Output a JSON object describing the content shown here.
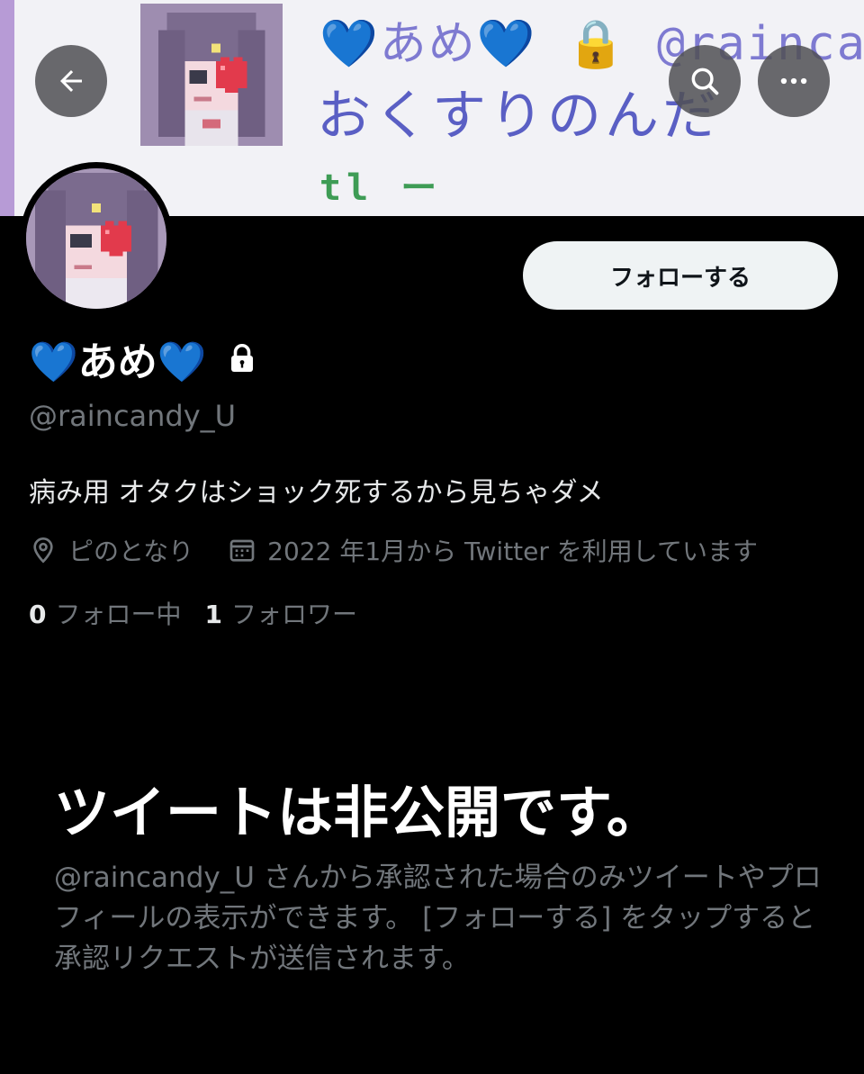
{
  "banner": {
    "line1": "💙あめ💙 🔒 @raincan",
    "line2": "おくすりのんだ",
    "line3": "tl ー"
  },
  "header": {
    "back_icon": "arrow-left-icon",
    "search_icon": "search-icon",
    "more_icon": "more-horizontal-icon"
  },
  "profile": {
    "display_name": "💙あめ💙",
    "handle": "@raincandy_U",
    "bio": "病み用 オタクはショック死するから見ちゃダメ",
    "location": "ピのとなり",
    "joined": "2022 年1月から Twitter を利用しています",
    "following_count": "0",
    "following_label": "フォロー中",
    "followers_count": "1",
    "followers_label": "フォロワー"
  },
  "follow_button": {
    "label": "フォローする"
  },
  "protected": {
    "title": "ツイートは非公開です。",
    "body": "@raincandy_U さんから承認された場合のみツイートやプロフィールの表示ができます。 [フォローする] をタップすると承認リクエストが送信されます。"
  },
  "colors": {
    "background": "#000000",
    "primary_text": "#e7e9ea",
    "secondary_text": "#71767b",
    "follow_button_bg": "#eff3f4",
    "banner_accent": "#b79bd6"
  }
}
